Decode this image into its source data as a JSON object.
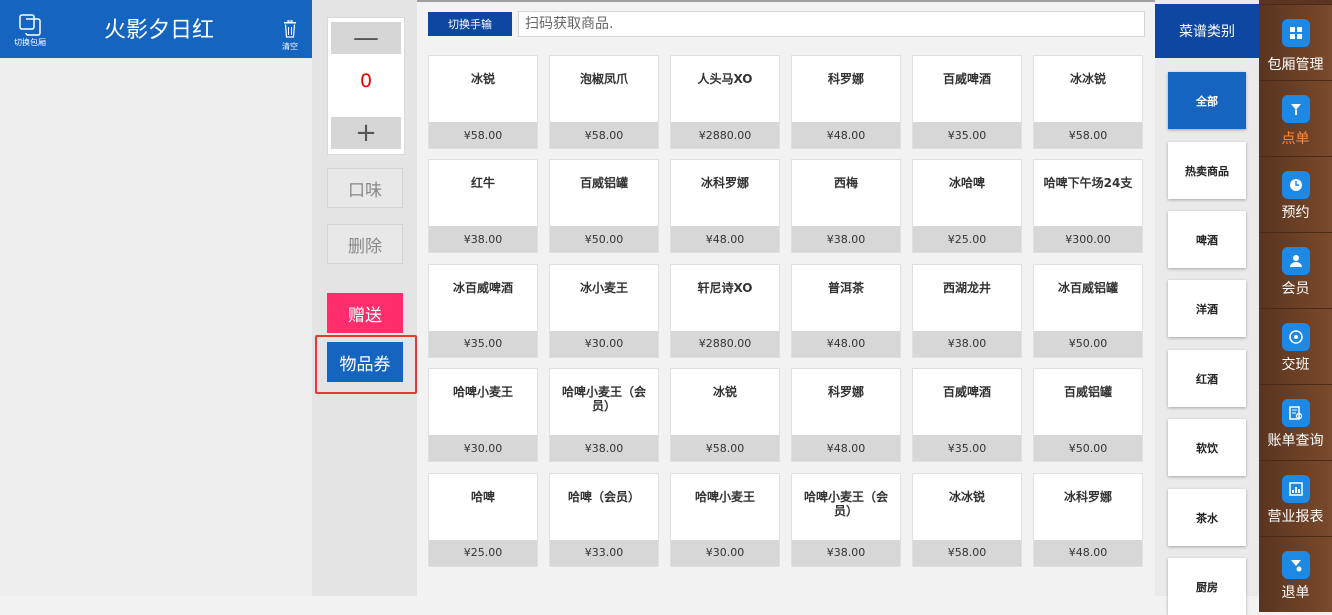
{
  "left_panel": {
    "switch_room_label": "切换包厢",
    "room_title": "火影夕日红",
    "clear_label": "清空"
  },
  "controls": {
    "minus": "—",
    "quantity": "0",
    "plus": "+",
    "taste": "口味",
    "delete": "删除",
    "gift": "赠送",
    "voucher": "物品券"
  },
  "search": {
    "toggle_label": "切换手输",
    "placeholder": "扫码获取商品."
  },
  "products": [
    {
      "name": "冰锐",
      "price": "¥58.00"
    },
    {
      "name": "泡椒凤爪",
      "price": "¥58.00"
    },
    {
      "name": "人头马XO",
      "price": "¥2880.00"
    },
    {
      "name": "科罗娜",
      "price": "¥48.00"
    },
    {
      "name": "百威啤酒",
      "price": "¥35.00"
    },
    {
      "name": "冰冰锐",
      "price": "¥58.00"
    },
    {
      "name": "红牛",
      "price": "¥38.00"
    },
    {
      "name": "百威铝罐",
      "price": "¥50.00"
    },
    {
      "name": "冰科罗娜",
      "price": "¥48.00"
    },
    {
      "name": "西梅",
      "price": "¥38.00"
    },
    {
      "name": "冰哈啤",
      "price": "¥25.00"
    },
    {
      "name": "哈啤下午场24支",
      "price": "¥300.00"
    },
    {
      "name": "冰百威啤酒",
      "price": "¥35.00"
    },
    {
      "name": "冰小麦王",
      "price": "¥30.00"
    },
    {
      "name": "轩尼诗XO",
      "price": "¥2880.00"
    },
    {
      "name": "普洱茶",
      "price": "¥48.00"
    },
    {
      "name": "西湖龙井",
      "price": "¥38.00"
    },
    {
      "name": "冰百威铝罐",
      "price": "¥50.00"
    },
    {
      "name": "哈啤小麦王",
      "price": "¥30.00"
    },
    {
      "name": "哈啤小麦王（会员）",
      "price": "¥38.00"
    },
    {
      "name": "冰锐",
      "price": "¥58.00"
    },
    {
      "name": "科罗娜",
      "price": "¥48.00"
    },
    {
      "name": "百威啤酒",
      "price": "¥35.00"
    },
    {
      "name": "百威铝罐",
      "price": "¥50.00"
    },
    {
      "name": "哈啤",
      "price": "¥25.00"
    },
    {
      "name": "哈啤（会员）",
      "price": "¥33.00"
    },
    {
      "name": "哈啤小麦王",
      "price": "¥30.00"
    },
    {
      "name": "哈啤小麦王（会员）",
      "price": "¥38.00"
    },
    {
      "name": "冰冰锐",
      "price": "¥58.00"
    },
    {
      "name": "冰科罗娜",
      "price": "¥48.00"
    }
  ],
  "categories": {
    "header": "菜谱类别",
    "items": [
      {
        "label": "全部",
        "active": true
      },
      {
        "label": "热卖商品",
        "active": false
      },
      {
        "label": "啤酒",
        "active": false
      },
      {
        "label": "洋酒",
        "active": false
      },
      {
        "label": "红酒",
        "active": false
      },
      {
        "label": "软饮",
        "active": false
      },
      {
        "label": "茶水",
        "active": false
      },
      {
        "label": "厨房",
        "active": false
      }
    ]
  },
  "nav": [
    {
      "label": "包厢管理",
      "icon": "grid-icon",
      "active": false
    },
    {
      "label": "点单",
      "icon": "order-icon",
      "active": true
    },
    {
      "label": "预约",
      "icon": "clock-icon",
      "active": false
    },
    {
      "label": "会员",
      "icon": "member-icon",
      "active": false
    },
    {
      "label": "交班",
      "icon": "shift-icon",
      "active": false
    },
    {
      "label": "账单查询",
      "icon": "bill-search-icon",
      "active": false
    },
    {
      "label": "营业报表",
      "icon": "report-icon",
      "active": false
    },
    {
      "label": "退单",
      "icon": "refund-icon",
      "active": false
    }
  ],
  "colors": {
    "primary": "#1565c0",
    "dark_blue": "#0d47a1",
    "gift": "#ff2d6b",
    "highlight_frame": "#e53935",
    "nav_bg": "#5c3520",
    "nav_active_text": "#ff8a3d"
  }
}
